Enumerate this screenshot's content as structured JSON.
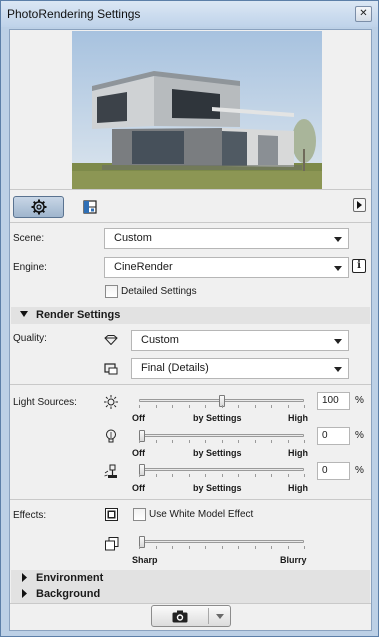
{
  "window": {
    "title": "PhotoRendering Settings",
    "close_glyph": "✕"
  },
  "toolbar": {
    "tabs": [
      {
        "icon": "gear-icon",
        "state": "selected"
      },
      {
        "icon": "layout-icon",
        "state": "unselected"
      }
    ],
    "menu_icon": "play-right-icon"
  },
  "scene": {
    "label": "Scene:",
    "value": "Custom"
  },
  "engine": {
    "label": "Engine:",
    "value": "CineRender",
    "info_glyph": "i"
  },
  "detailed_settings": {
    "label": "Detailed Settings",
    "checked": false
  },
  "render_settings": {
    "title": "Render Settings",
    "quality_label": "Quality:",
    "quality_value": "Custom",
    "quality_detail_value": "Final (Details)"
  },
  "light_sources": {
    "label": "Light Sources:",
    "percent": "%",
    "rows": [
      {
        "icon": "sun-icon",
        "value": "100",
        "level": 0.5,
        "left": "Off",
        "mid": "by Settings",
        "right": "High"
      },
      {
        "icon": "bulb-icon",
        "value": "0",
        "level": 0.0,
        "left": "Off",
        "mid": "by Settings",
        "right": "High"
      },
      {
        "icon": "lamp-icon",
        "value": "0",
        "level": 0.0,
        "left": "Off",
        "mid": "by Settings",
        "right": "High"
      }
    ]
  },
  "effects": {
    "label": "Effects:",
    "white_model_label": "Use White Model Effect",
    "white_model_checked": false,
    "blur_level": 0.0,
    "blur_left": "Sharp",
    "blur_right": "Blurry"
  },
  "sections": {
    "environment": "Environment",
    "background": "Background"
  },
  "footer": {
    "render_icon": "camera-icon"
  },
  "colors": {
    "title_bar": "#bfd3ea",
    "panel": "#f0f0f0",
    "section_header": "#e2e2e2"
  }
}
